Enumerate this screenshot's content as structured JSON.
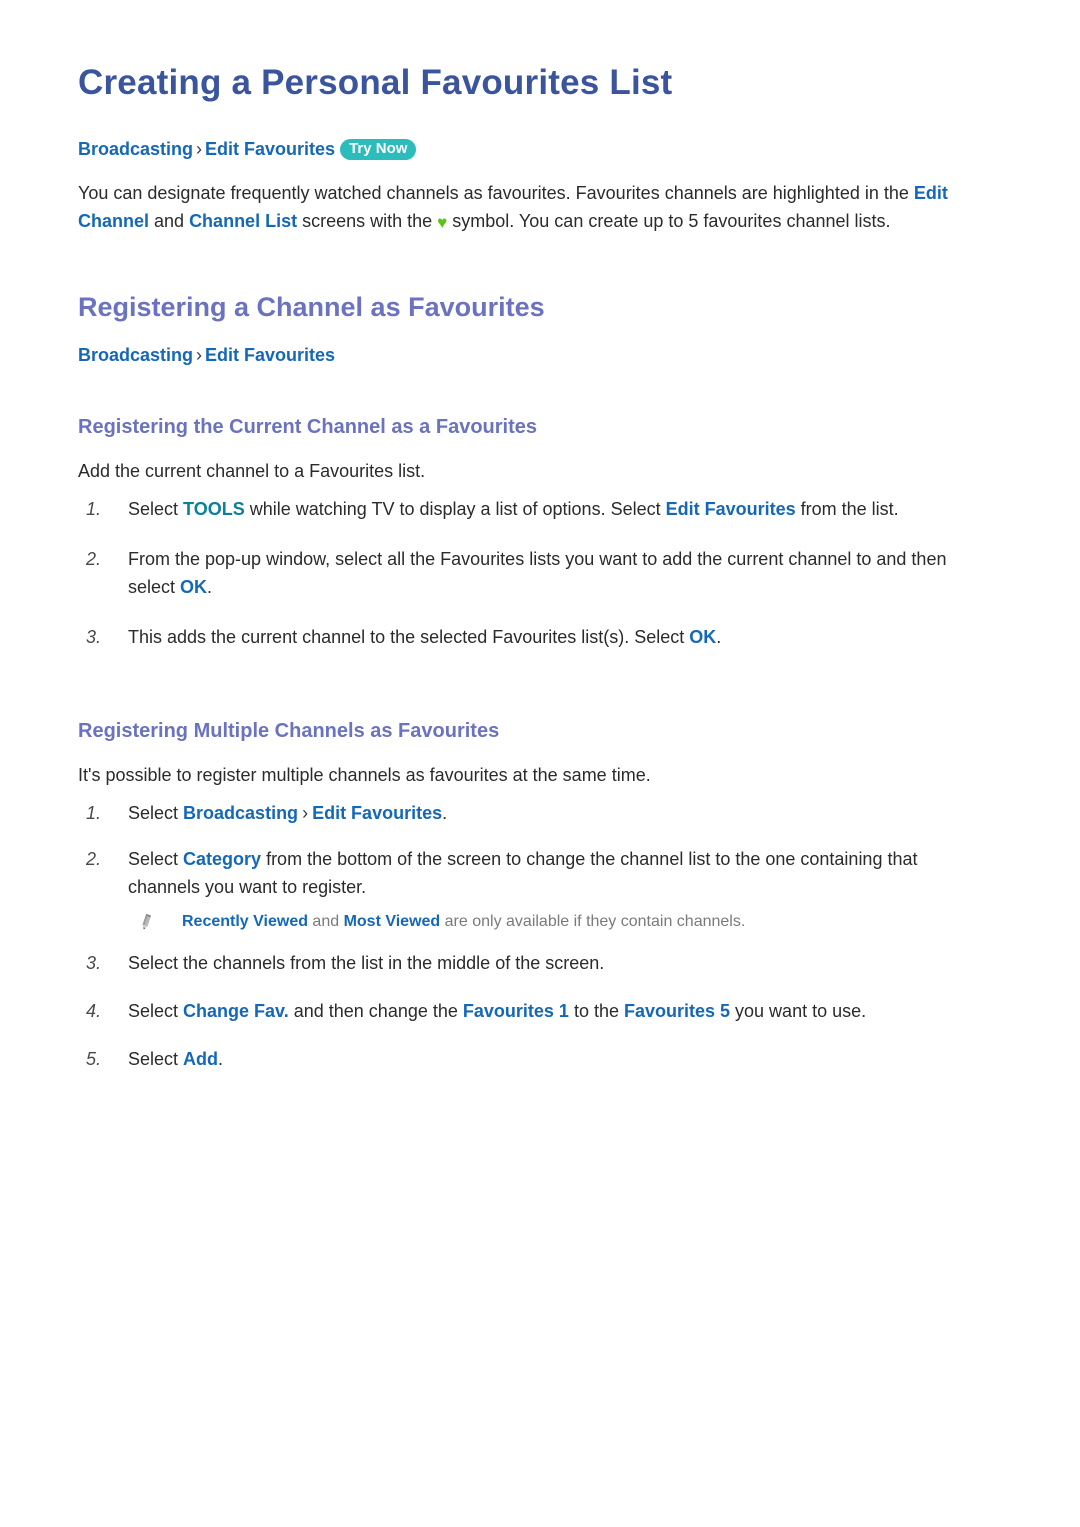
{
  "page": {
    "title": "Creating a Personal Favourites List"
  },
  "top_breadcrumb": {
    "first": "Broadcasting",
    "separator": "›",
    "second": "Edit Favourites",
    "badge": "Try Now"
  },
  "intro": {
    "part1": "You can designate frequently watched channels as favourites. Favourites channels are highlighted in the ",
    "kw1": "Edit Channel",
    "part2": " and ",
    "kw2": "Channel List",
    "part3": " screens with the ",
    "heart_icon": "♥",
    "part4": " symbol. You can create up to 5 favourites channel lists."
  },
  "section_registering_channel": {
    "heading": "Registering a Channel as Favourites",
    "breadcrumb": {
      "first": "Broadcasting",
      "separator": "›",
      "second": "Edit Favourites"
    }
  },
  "section_current_channel": {
    "heading": "Registering the Current Channel as a Favourites",
    "intro": "Add the current channel to a Favourites list.",
    "steps": [
      {
        "num": "1.",
        "p1": "Select ",
        "kw1": "TOOLS",
        "p2": " while watching TV to display a list of options. Select ",
        "kw2": "Edit Favourites",
        "p3": " from the list."
      },
      {
        "num": "2.",
        "p1": "From the pop-up window, select all the Favourites lists you want to add the current channel to and then select ",
        "kw1": "OK",
        "p2": "."
      },
      {
        "num": "3.",
        "p1": "This adds the current channel to the selected Favourites list(s). Select ",
        "kw1": "OK",
        "p2": "."
      }
    ]
  },
  "section_multiple_channels": {
    "heading": "Registering Multiple Channels as Favourites",
    "intro": "It's possible to register multiple channels as favourites at the same time.",
    "step1": {
      "num": "1.",
      "p1": "Select ",
      "kw1": "Broadcasting",
      "sep": "›",
      "kw2": "Edit Favourites",
      "p2": "."
    },
    "step2": {
      "num": "2.",
      "p1": "Select ",
      "kw1": "Category",
      "p2": " from the bottom of the screen to change the channel list to the one containing that channels you want to register."
    },
    "note": {
      "icon": "pencil-icon",
      "kw1": "Recently Viewed",
      "p1": " and ",
      "kw2": "Most Viewed",
      "p2": " are only available if they contain channels."
    },
    "step3": {
      "num": "3.",
      "p1": "Select the channels from the list in the middle of the screen."
    },
    "step4": {
      "num": "4.",
      "p1": "Select ",
      "kw1": "Change Fav.",
      "p2": " and then change the ",
      "kw2": "Favourites 1",
      "p3": " to the ",
      "kw3": "Favourites 5",
      "p4": " you want to use."
    },
    "step5": {
      "num": "5.",
      "p1": "Select ",
      "kw1": "Add",
      "p2": "."
    }
  },
  "colors": {
    "h1": "#3b549e",
    "h2": "#6b72bf",
    "link_blue": "#1568b8",
    "tools_teal": "#0a7f9e",
    "badge_bg": "#2cbcbc",
    "heart_green": "#5cc314",
    "note_gray": "#7a7a7a"
  }
}
